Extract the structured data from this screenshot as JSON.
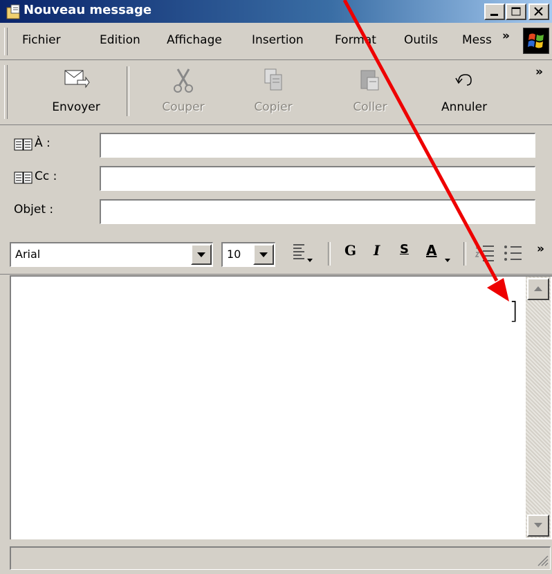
{
  "window": {
    "title": "Nouveau message"
  },
  "menu": {
    "items": [
      "Fichier",
      "Edition",
      "Affichage",
      "Insertion",
      "Format",
      "Outils",
      "Mess"
    ],
    "overflow": "»"
  },
  "toolbar": {
    "send": "Envoyer",
    "cut": "Couper",
    "copy": "Copier",
    "paste": "Coller",
    "undo": "Annuler",
    "overflow": "»"
  },
  "fields": {
    "to_label": "À :",
    "to_value": "",
    "cc_label": "Cc :",
    "cc_value": "",
    "subject_label": "Objet :",
    "subject_value": ""
  },
  "format": {
    "font": "Arial",
    "size": "10",
    "bold": "G",
    "italic": "I",
    "underline": "S",
    "color": "A",
    "overflow": "»"
  },
  "body": {
    "cursor": "]"
  },
  "annotation": {
    "color": "#ee0000"
  }
}
